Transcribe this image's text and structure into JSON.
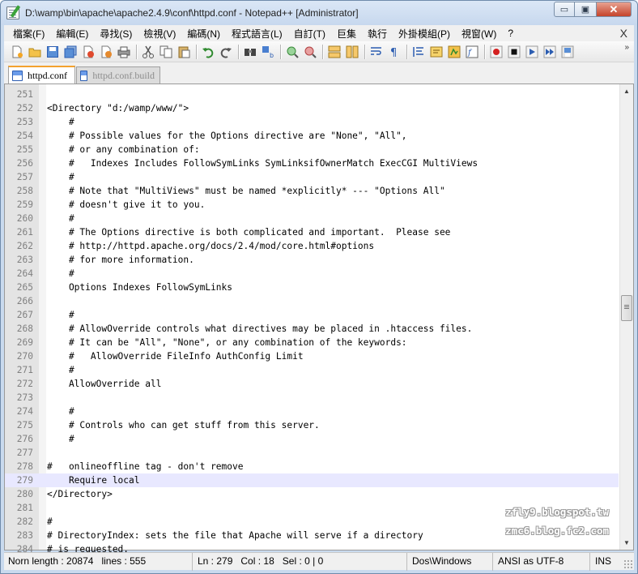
{
  "window": {
    "title": "D:\\wamp\\bin\\apache\\apache2.4.9\\conf\\httpd.conf - Notepad++ [Administrator]",
    "controls": {
      "minimize": "▭",
      "maximize": "▣",
      "close": "✕"
    }
  },
  "menu": {
    "items": [
      "檔案(F)",
      "編輯(E)",
      "尋找(S)",
      "檢視(V)",
      "編碼(N)",
      "程式語言(L)",
      "自訂(T)",
      "巨集",
      "執行",
      "外掛模組(P)",
      "視窗(W)",
      "?"
    ],
    "close_glyph": "X"
  },
  "toolbar": {
    "buttons": [
      "new-file",
      "open-file",
      "save",
      "save-all",
      "close",
      "close-all",
      "print",
      "cut",
      "copy",
      "paste",
      "undo",
      "redo",
      "find",
      "replace",
      "zoom-in",
      "zoom-out",
      "sync-vertical",
      "sync-horizontal",
      "word-wrap",
      "show-all-chars",
      "indent-guide",
      "user-defined-language",
      "document-map",
      "function-list",
      "record-macro",
      "stop-macro",
      "play-macro",
      "run-macro-multiple",
      "save-macro"
    ],
    "overflow_glyph": "»"
  },
  "tabs": [
    {
      "label": "httpd.conf",
      "active": true
    },
    {
      "label": "httpd.conf.build",
      "active": false
    }
  ],
  "editor": {
    "current_line": 279,
    "lines": [
      {
        "n": "251",
        "text": ""
      },
      {
        "n": "252",
        "text": "<Directory \"d:/wamp/www/\">"
      },
      {
        "n": "253",
        "text": "    #"
      },
      {
        "n": "254",
        "text": "    # Possible values for the Options directive are \"None\", \"All\","
      },
      {
        "n": "255",
        "text": "    # or any combination of:"
      },
      {
        "n": "256",
        "text": "    #   Indexes Includes FollowSymLinks SymLinksifOwnerMatch ExecCGI MultiViews"
      },
      {
        "n": "257",
        "text": "    #"
      },
      {
        "n": "258",
        "text": "    # Note that \"MultiViews\" must be named *explicitly* --- \"Options All\""
      },
      {
        "n": "259",
        "text": "    # doesn't give it to you."
      },
      {
        "n": "260",
        "text": "    #"
      },
      {
        "n": "261",
        "text": "    # The Options directive is both complicated and important.  Please see"
      },
      {
        "n": "262",
        "text": "    # http://httpd.apache.org/docs/2.4/mod/core.html#options"
      },
      {
        "n": "263",
        "text": "    # for more information."
      },
      {
        "n": "264",
        "text": "    #"
      },
      {
        "n": "265",
        "text": "    Options Indexes FollowSymLinks"
      },
      {
        "n": "266",
        "text": ""
      },
      {
        "n": "267",
        "text": "    #"
      },
      {
        "n": "268",
        "text": "    # AllowOverride controls what directives may be placed in .htaccess files."
      },
      {
        "n": "269",
        "text": "    # It can be \"All\", \"None\", or any combination of the keywords:"
      },
      {
        "n": "270",
        "text": "    #   AllowOverride FileInfo AuthConfig Limit"
      },
      {
        "n": "271",
        "text": "    #"
      },
      {
        "n": "272",
        "text": "    AllowOverride all"
      },
      {
        "n": "273",
        "text": ""
      },
      {
        "n": "274",
        "text": "    #"
      },
      {
        "n": "275",
        "text": "    # Controls who can get stuff from this server."
      },
      {
        "n": "276",
        "text": "    #"
      },
      {
        "n": "277",
        "text": ""
      },
      {
        "n": "278",
        "text": "#   onlineoffline tag - don't remove"
      },
      {
        "n": "279",
        "text": "    Require local"
      },
      {
        "n": "280",
        "text": "</Directory>"
      },
      {
        "n": "281",
        "text": ""
      },
      {
        "n": "282",
        "text": "#"
      },
      {
        "n": "283",
        "text": "# DirectoryIndex: sets the file that Apache will serve if a directory"
      },
      {
        "n": "284",
        "text": "# is requested."
      }
    ]
  },
  "watermark": {
    "line1": "zfly9.blogspot.tw",
    "line2": "zmc6.blog.fc2.com"
  },
  "status": {
    "length": "Norn length : 20874",
    "lines": "lines : 555",
    "position": "Ln : 279",
    "column": "Col : 18",
    "selection": "Sel : 0 | 0",
    "eol": "Dos\\Windows",
    "encoding": "ANSI as UTF-8",
    "mode": "INS"
  },
  "colors": {
    "current_line": "#e8e8ff",
    "tab_accent": "#f3a12d",
    "gutter": "#e4e4e4",
    "line_number": "#808080"
  }
}
